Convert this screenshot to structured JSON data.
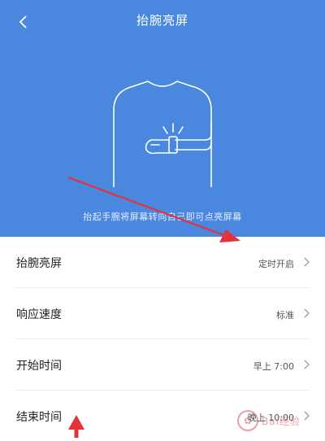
{
  "header": {
    "title": "抬腕亮屏",
    "hint": "抬起手腕将屏幕转向自己即可点亮屏幕",
    "background": "#4a88e0"
  },
  "settings": [
    {
      "label": "抬腕亮屏",
      "value": "定时开启"
    },
    {
      "label": "响应速度",
      "value": "标准"
    },
    {
      "label": "开始时间",
      "value": "早上 7:00"
    },
    {
      "label": "结束时间",
      "value": "晚上 10:00"
    }
  ],
  "annotations": {
    "color": "#e8303a"
  },
  "watermark": {
    "text": "Bai经验"
  },
  "icons": {
    "back": "chevron-left-icon",
    "row": "chevron-right-icon"
  }
}
